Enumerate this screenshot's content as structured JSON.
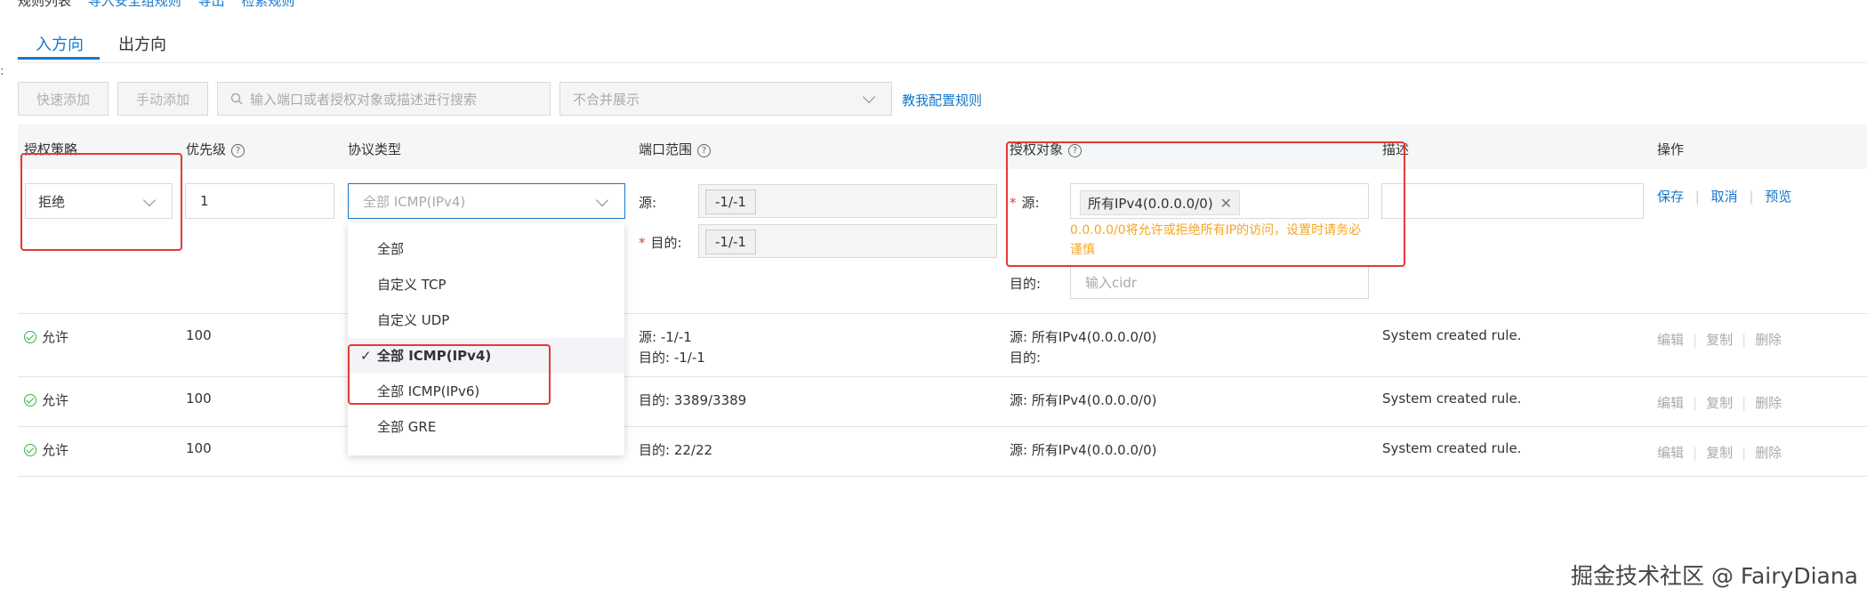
{
  "top_partial": {
    "text": "规则列表",
    "links": [
      "导入安全组规则",
      "导出",
      "检索规则"
    ]
  },
  "tabs": [
    {
      "label": "入方向",
      "active": true
    },
    {
      "label": "出方向",
      "active": false
    }
  ],
  "toolbar": {
    "quick_add": "快速添加",
    "manual_add": "手动添加",
    "search_placeholder": "输入端口或者授权对象或描述进行搜索",
    "display_mode": "不合并展示",
    "help_link": "教我配置规则"
  },
  "columns": [
    "授权策略",
    "优先级",
    "协议类型",
    "端口范围",
    "授权对象",
    "描述",
    "操作"
  ],
  "edit_row": {
    "policy": "拒绝",
    "priority": "1",
    "protocol_placeholder": "全部 ICMP(IPv4)",
    "port_src_label": "源:",
    "port_src_value": "-1/-1",
    "port_dst_label": "目的:",
    "port_dst_value": "-1/-1",
    "auth_src_label": "源:",
    "auth_src_tag": "所有IPv4(0.0.0.0/0)",
    "warning": "0.0.0.0/0将允许或拒绝所有IP的访问，设置时请务必谨慎",
    "auth_dst_label": "目的:",
    "auth_dst_placeholder": "输入cidr",
    "actions": [
      "保存",
      "取消",
      "预览"
    ]
  },
  "protocol_options": [
    {
      "label": "全部",
      "selected": false
    },
    {
      "label": "自定义 TCP",
      "selected": false
    },
    {
      "label": "自定义 UDP",
      "selected": false
    },
    {
      "label": "全部 ICMP(IPv4)",
      "selected": true
    },
    {
      "label": "全部 ICMP(IPv6)",
      "selected": false
    },
    {
      "label": "全部 GRE",
      "selected": false
    }
  ],
  "rows": [
    {
      "policy": "允许",
      "priority": "100",
      "port_lines": [
        "源: -1/-1",
        "目的: -1/-1"
      ],
      "auth_lines": [
        "源: 所有IPv4(0.0.0.0/0)",
        "目的:"
      ],
      "desc": "System created rule."
    },
    {
      "policy": "允许",
      "priority": "100",
      "port_lines": [
        "目的: 3389/3389"
      ],
      "auth_lines": [
        "源: 所有IPv4(0.0.0.0/0)"
      ],
      "desc": "System created rule."
    },
    {
      "policy": "允许",
      "priority": "100",
      "port_lines": [
        "目的: 22/22"
      ],
      "auth_lines": [
        "源: 所有IPv4(0.0.0.0/0)"
      ],
      "desc": "System created rule."
    }
  ],
  "row_actions": [
    "编辑",
    "复制",
    "删除"
  ],
  "watermark": "掘金技术社区 @ FairyDiana",
  "colors": {
    "accent": "#1677cc",
    "highlight": "#e53935",
    "warning": "#f5a623",
    "ok": "#3bb34a"
  }
}
